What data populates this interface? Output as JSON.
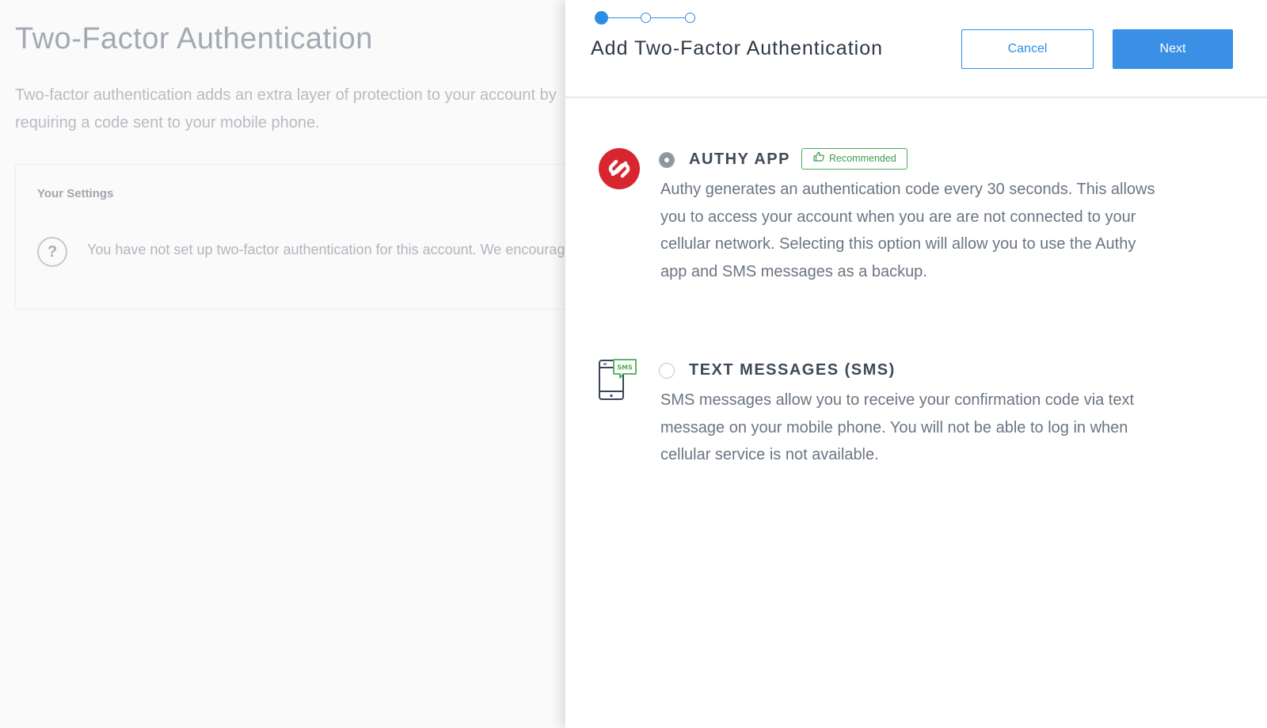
{
  "background": {
    "title": "Two-Factor Authentication",
    "description": "Two-factor authentication adds an extra layer of protection to your account by requiring a code sent to your mobile phone.",
    "settings_card": {
      "title": "Your Settings",
      "help_icon": "question-circle-icon",
      "message": "You have not set up two-factor authentication for this account. We encourage you to enable it."
    }
  },
  "drawer": {
    "stepper": {
      "current_step": 1,
      "total_steps": 3
    },
    "title": "Add Two-Factor Authentication",
    "cancel_label": "Cancel",
    "next_label": "Next",
    "options": {
      "authy": {
        "icon": "authy-logo-icon",
        "label": "AUTHY APP",
        "selected": true,
        "badge": "Recommended",
        "badge_icon": "thumbs-up-icon",
        "description": "Authy generates an authentication code every 30 seconds. This allows you to access your account when you are are not connected to your cellular network. Selecting this option will allow you to use the Authy app and SMS messages as a backup."
      },
      "sms": {
        "icon": "sms-phone-icon",
        "icon_text": "SMS",
        "label": "TEXT MESSAGES (SMS)",
        "selected": false,
        "description": "SMS messages allow you to receive your confirmation code via text message on your mobile phone. You will not be able to log in when cellular service is not available."
      }
    }
  },
  "colors": {
    "accent": "#2d8de6",
    "authy_red": "#d8262f",
    "recommended_green": "#46ae55"
  }
}
